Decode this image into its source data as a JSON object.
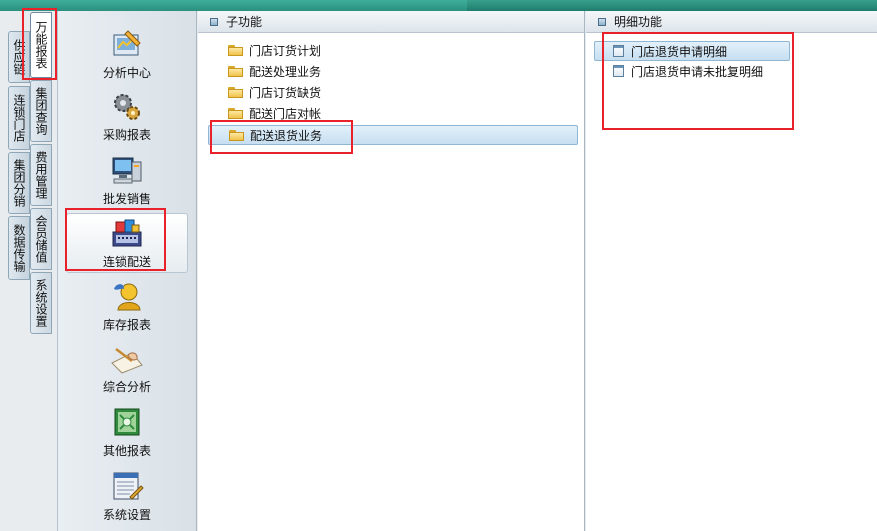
{
  "vertical_tabs_col1": [
    {
      "label": "供应链"
    },
    {
      "label": "连锁门店"
    },
    {
      "label": "集团分销"
    },
    {
      "label": "数据传输"
    }
  ],
  "vertical_tabs_col2": [
    {
      "label": "万能报表",
      "active": true
    },
    {
      "label": "集团查询"
    },
    {
      "label": "费用管理"
    },
    {
      "label": "会员储值"
    },
    {
      "label": "系统设置"
    }
  ],
  "icon_sidebar": [
    {
      "label": "分析中心",
      "icon": "analysis-icon"
    },
    {
      "label": "采购报表",
      "icon": "gears-icon"
    },
    {
      "label": "批发销售",
      "icon": "computer-icon"
    },
    {
      "label": "连锁配送",
      "icon": "cash-register-icon",
      "selected": true
    },
    {
      "label": "库存报表",
      "icon": "user-icon"
    },
    {
      "label": "综合分析",
      "icon": "hand-writing-icon"
    },
    {
      "label": "其他报表",
      "icon": "money-icon"
    },
    {
      "label": "系统设置",
      "icon": "settings-form-icon"
    }
  ],
  "sub_panel": {
    "title": "子功能",
    "items": [
      {
        "label": "门店订货计划"
      },
      {
        "label": "配送处理业务"
      },
      {
        "label": "门店订货缺货"
      },
      {
        "label": "配送门店对帐"
      },
      {
        "label": "配送退货业务",
        "selected": true
      }
    ]
  },
  "detail_panel": {
    "title": "明细功能",
    "items": [
      {
        "label": "门店退货申请明细",
        "selected": true
      },
      {
        "label": "门店退货申请未批复明细"
      }
    ]
  },
  "colors": {
    "accent_teal": "#2a8f7e",
    "highlight_red": "#e8212b",
    "selection_blue": "#c6dff1"
  }
}
